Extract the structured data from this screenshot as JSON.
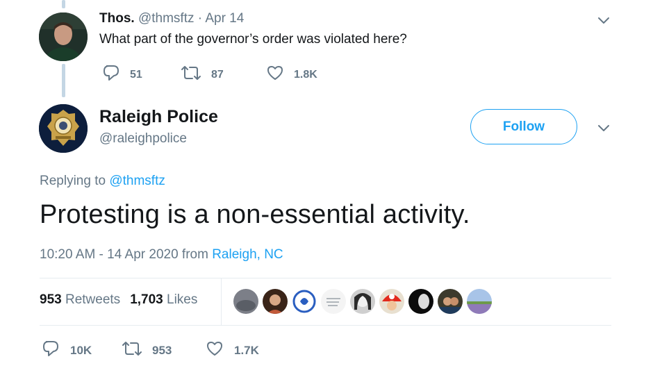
{
  "parent_tweet": {
    "name": "Thos.",
    "handle": "@thmsftz",
    "separator": "·",
    "date": "Apr 14",
    "text": "What part of the governor’s order was violated here?",
    "replies": "51",
    "retweets": "87",
    "likes": "1.8K"
  },
  "main_tweet": {
    "name": "Raleigh Police",
    "handle": "@raleighpolice",
    "follow_label": "Follow",
    "replying_prefix": "Replying to",
    "replying_to": "@thmsftz",
    "text": "Protesting is a non-essential activity.",
    "timestamp": "10:20 AM - 14 Apr 2020 from",
    "location": "Raleigh, NC",
    "retweet_count": "953",
    "retweet_label": "Retweets",
    "like_count": "1,703",
    "like_label": "Likes",
    "actions": {
      "replies": "10K",
      "retweets": "953",
      "likes": "1.7K"
    }
  },
  "icons": [
    "reply-icon",
    "retweet-icon",
    "heart-icon",
    "chevron-down-icon"
  ],
  "colors": {
    "accent": "#1da1f2",
    "muted": "#657786",
    "text": "#14171a",
    "thread_line": "#c4d6e4",
    "divider": "#e6ecf0"
  }
}
